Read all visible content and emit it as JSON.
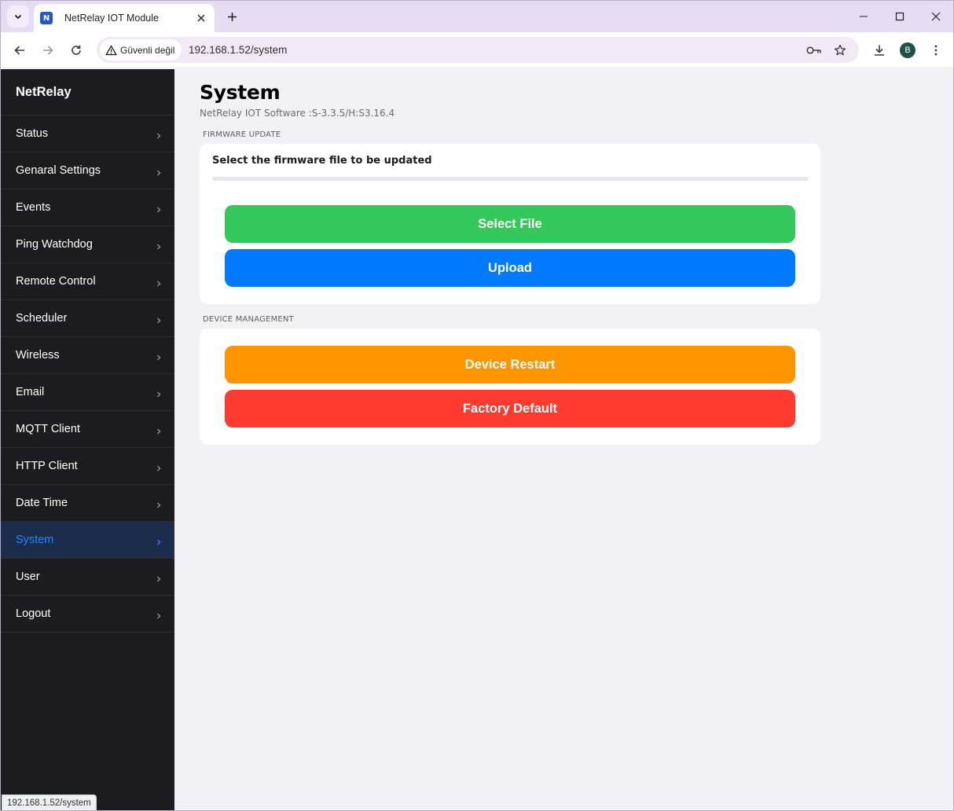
{
  "browser": {
    "tab_title": "NetRelay IOT Module",
    "favicon_letter": "N",
    "security_label": "Güvenli değil",
    "url": "192.168.1.52/system",
    "profile_initial": "B",
    "status_bar_url": "192.168.1.52/system"
  },
  "sidebar": {
    "brand": "NetRelay",
    "items": [
      {
        "label": "Status"
      },
      {
        "label": "Genaral Settings"
      },
      {
        "label": "Events"
      },
      {
        "label": "Ping Watchdog"
      },
      {
        "label": "Remote Control"
      },
      {
        "label": "Scheduler"
      },
      {
        "label": "Wireless"
      },
      {
        "label": "Email"
      },
      {
        "label": "MQTT Client"
      },
      {
        "label": "HTTP Client"
      },
      {
        "label": "Date Time"
      },
      {
        "label": "System",
        "active": true
      },
      {
        "label": "User"
      },
      {
        "label": "Logout"
      }
    ]
  },
  "main": {
    "title": "System",
    "subtitle": "NetRelay IOT Software :S-3.3.5/H:S3.16.4",
    "firmware_section": {
      "header": "FIRMWARE UPDATE",
      "label": "Select the firmware file to be updated",
      "progress": 0,
      "select_file_label": "Select File",
      "upload_label": "Upload"
    },
    "device_section": {
      "header": "DEVICE MANAGEMENT",
      "restart_label": "Device Restart",
      "factory_label": "Factory Default"
    }
  },
  "colors": {
    "sidebar_bg": "#1c1c1e",
    "active_item": "#1f85ff",
    "select_file": "#34c759",
    "upload": "#007aff",
    "restart": "#ff9500",
    "factory_default": "#ff3b30"
  }
}
